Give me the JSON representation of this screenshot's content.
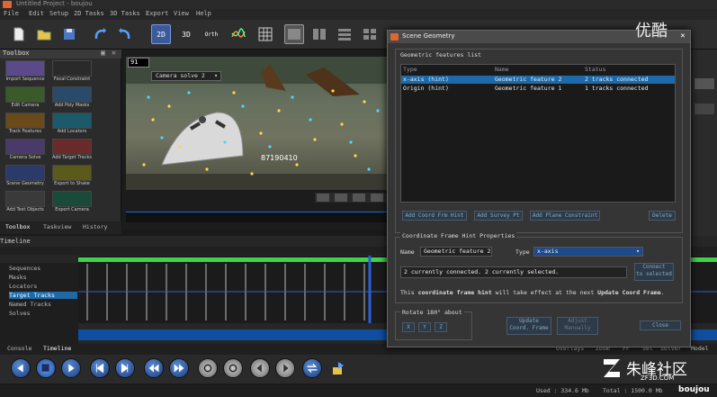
{
  "window": {
    "title": "Untitled Project - boujou"
  },
  "menu": [
    "File",
    "Edit",
    "Setup",
    "2D Tasks",
    "3D Tasks",
    "Export",
    "View",
    "Help"
  ],
  "toolbar_labels": {
    "view_2d": "2D",
    "view_3d": "3D",
    "view_orth": "Orth"
  },
  "toolbox": {
    "title": "Toolbox",
    "tools": [
      {
        "label": "Import Sequence",
        "icon": "film-icon"
      },
      {
        "label": "Focal Constraint",
        "icon": "focal-icon"
      },
      {
        "label": "Edit Camera",
        "icon": "camera-edit-icon"
      },
      {
        "label": "Add Poly Masks",
        "icon": "mask-icon"
      },
      {
        "label": "Track Features",
        "icon": "track-icon"
      },
      {
        "label": "Add Locators",
        "icon": "locator-icon"
      },
      {
        "label": "Camera Solve",
        "icon": "solve-icon"
      },
      {
        "label": "Add Target Tracks",
        "icon": "target-icon"
      },
      {
        "label": "Scene Geometry",
        "icon": "geometry-icon"
      },
      {
        "label": "Export to Shake",
        "icon": "export-shake-icon"
      },
      {
        "label": "Add Test Objects",
        "icon": "test-objects-icon"
      },
      {
        "label": "Export Camera",
        "icon": "export-camera-icon"
      }
    ],
    "tabs": [
      "Toolbox",
      "Taskview",
      "History"
    ]
  },
  "viewport": {
    "frame": "91",
    "camera": "Camera solve 2",
    "label": "87190410"
  },
  "timeline": {
    "title": "Timeline",
    "tree": [
      "Sequences",
      "Masks",
      "Locators",
      "Target Tracks",
      "Named Tracks",
      "Solves"
    ],
    "selected": "Target Tracks"
  },
  "bottom_tabs": [
    "Console",
    "Timeline"
  ],
  "status": {
    "used": "Used : 334.6 Mb",
    "total": "Total : 1500.0 Mb"
  },
  "right_labels": [
    "Overlays",
    "Zoom",
    "FF",
    "Sel",
    "Solver",
    "Model"
  ],
  "dialog": {
    "title": "Scene Geometry",
    "features_group": "Geometric features list",
    "columns": [
      "Type",
      "Name",
      "Status"
    ],
    "rows": [
      {
        "type": "x-axis (hint)",
        "name": "Geometric feature 2",
        "status": "2 tracks connected",
        "selected": true
      },
      {
        "type": "Origin (hint)",
        "name": "Geometric feature 1",
        "status": "1 tracks connected",
        "selected": false
      }
    ],
    "buttons": {
      "add_coord": "Add Coord Frm Hint",
      "add_survey": "Add Survey Pt",
      "add_plane": "Add Plane Constraint",
      "delete": "Delete"
    },
    "props_group": "Coordinate Frame Hint Properties",
    "name_label": "Name",
    "name_value": "Geometric feature 2",
    "type_label": "Type",
    "type_value": "x-axis",
    "connected_text": "2 currently connected. 2 currently selected.",
    "connect_btn_1": "Connect",
    "connect_btn_2": "to selected",
    "hint_prefix": "This ",
    "hint_bold1": "coordinate frame hint",
    "hint_mid": " will take effect at the next ",
    "hint_bold2": "Update Coord Frame",
    "hint_end": ".",
    "rotate_label": "Rotate 180° about",
    "rotate_axes": [
      "X",
      "Y",
      "Z"
    ],
    "update_1": "Update",
    "update_2": "Coord. Frame",
    "adjust_1": "Adjust",
    "adjust_2": "Manually",
    "close": "Close"
  },
  "watermarks": {
    "youku": "优酷",
    "zf3d": "朱峰社区",
    "zf3d_url": "ZF3D.COM",
    "boujou": "boujou"
  }
}
